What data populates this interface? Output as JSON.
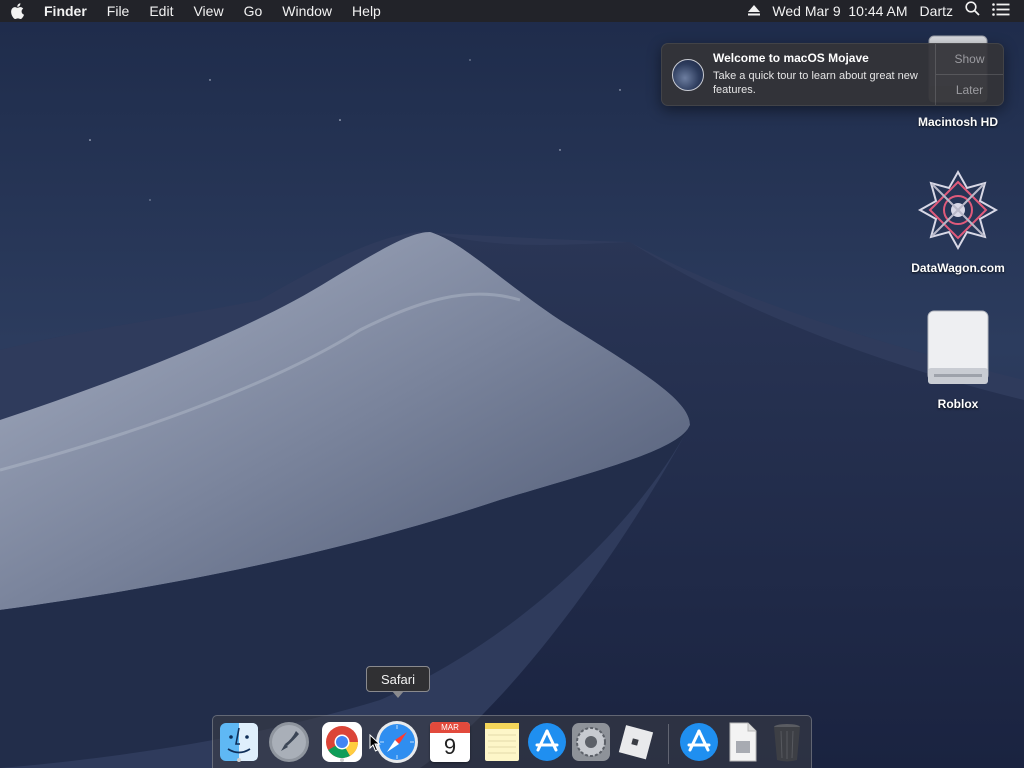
{
  "menubar": {
    "apple_icon": "apple-logo-icon",
    "app_name": "Finder",
    "menus": [
      "File",
      "Edit",
      "View",
      "Go",
      "Window",
      "Help"
    ],
    "eject_icon": "eject-icon",
    "datetime": "Wed Mar 9  10:44 AM",
    "user": "Dartz",
    "spotlight_icon": "search-icon",
    "notification_center_icon": "list-icon"
  },
  "notification": {
    "title": "Welcome to macOS Mojave",
    "text": "Take a quick tour to learn about great new features.",
    "show_label": "Show",
    "later_label": "Later"
  },
  "desktop_icons": [
    {
      "label": "Macintosh HD",
      "icon": "hard-drive-icon"
    },
    {
      "label": "DataWagon.com",
      "icon": "network-volume-icon"
    },
    {
      "label": "Roblox",
      "icon": "removable-drive-icon"
    }
  ],
  "dock": {
    "tooltip": "Safari",
    "calendar_month": "MAR",
    "calendar_day": "9",
    "items": [
      {
        "name": "Finder",
        "icon": "finder-icon",
        "running": true
      },
      {
        "name": "Launchpad",
        "icon": "launchpad-icon",
        "running": false
      },
      {
        "name": "Google Chrome",
        "icon": "chrome-icon",
        "running": true
      },
      {
        "name": "Safari",
        "icon": "safari-icon",
        "running": false
      },
      {
        "name": "Calendar",
        "icon": "calendar-icon",
        "running": false
      },
      {
        "name": "Notes",
        "icon": "notes-icon",
        "running": false
      },
      {
        "name": "App Store",
        "icon": "app-store-icon",
        "running": false
      },
      {
        "name": "System Preferences",
        "icon": "system-preferences-icon",
        "running": false
      },
      {
        "name": "Roblox",
        "icon": "roblox-icon",
        "running": false
      },
      {
        "name": "Downloads",
        "icon": "app-store-icon",
        "running": false
      },
      {
        "name": "Document",
        "icon": "document-icon",
        "running": false
      },
      {
        "name": "Trash",
        "icon": "trash-icon",
        "running": false
      }
    ]
  }
}
